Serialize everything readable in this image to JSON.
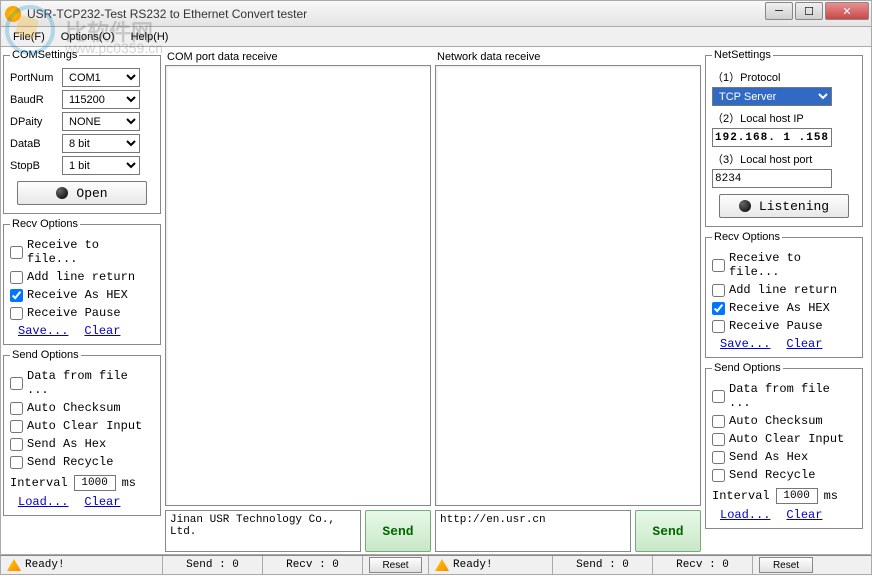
{
  "window": {
    "title": "USR-TCP232-Test  RS232 to Ethernet Convert tester"
  },
  "menu": {
    "file": "File(F)",
    "options": "Options(O)",
    "help": "Help(H)"
  },
  "watermark": {
    "text": "比软件网",
    "url": "www.pc0359.cn"
  },
  "com": {
    "legend": "COMSettings",
    "portnum_label": "PortNum",
    "portnum": "COM1",
    "baud_label": "BaudR",
    "baud": "115200",
    "parity_label": "DPaity",
    "parity": "NONE",
    "datab_label": "DataB",
    "datab": "8 bit",
    "stopb_label": "StopB",
    "stopb": "1 bit",
    "open": "Open"
  },
  "net": {
    "legend": "NetSettings",
    "proto_label": "（1）Protocol",
    "proto": "TCP Server",
    "ip_label": "（2）Local host IP",
    "ip": "192.168. 1 .158",
    "port_label": "（3）Local host port",
    "port": "8234",
    "listen": "Listening"
  },
  "recv_l": {
    "legend": "Recv Options",
    "file": "Receive to file...",
    "line": "Add line return",
    "hex": "Receive As HEX",
    "pause": "Receive Pause",
    "save": "Save...",
    "clear": "Clear"
  },
  "recv_r": {
    "legend": "Recv Options",
    "file": "Receive to file...",
    "line": "Add line return",
    "hex": "Receive As HEX",
    "pause": "Receive Pause",
    "save": "Save...",
    "clear": "Clear"
  },
  "send_l": {
    "legend": "Send Options",
    "file": "Data from file ...",
    "cksum": "Auto Checksum",
    "clr": "Auto Clear Input",
    "hex": "Send As Hex",
    "recycle": "Send Recycle",
    "interval_label": "Interval",
    "interval": "1000",
    "ms": "ms",
    "load": "Load...",
    "clear": "Clear"
  },
  "send_r": {
    "legend": "Send Options",
    "file": "Data from file ...",
    "cksum": "Auto Checksum",
    "clr": "Auto Clear Input",
    "hex": "Send As Hex",
    "recycle": "Send Recycle",
    "interval_label": "Interval",
    "interval": "1000",
    "ms": "ms",
    "load": "Load...",
    "clear": "Clear"
  },
  "center1": {
    "label": "COM port data receive",
    "sendtext": "Jinan USR Technology Co., Ltd.",
    "sendbtn": "Send"
  },
  "center2": {
    "label": "Network data receive",
    "sendtext": "http://en.usr.cn",
    "sendbtn": "Send"
  },
  "status": {
    "ready1": "Ready!",
    "send1": "Send : 0",
    "recv1": "Recv : 0",
    "reset1": "Reset",
    "ready2": "Ready!",
    "send2": "Send : 0",
    "recv2": "Recv : 0",
    "reset2": "Reset"
  }
}
